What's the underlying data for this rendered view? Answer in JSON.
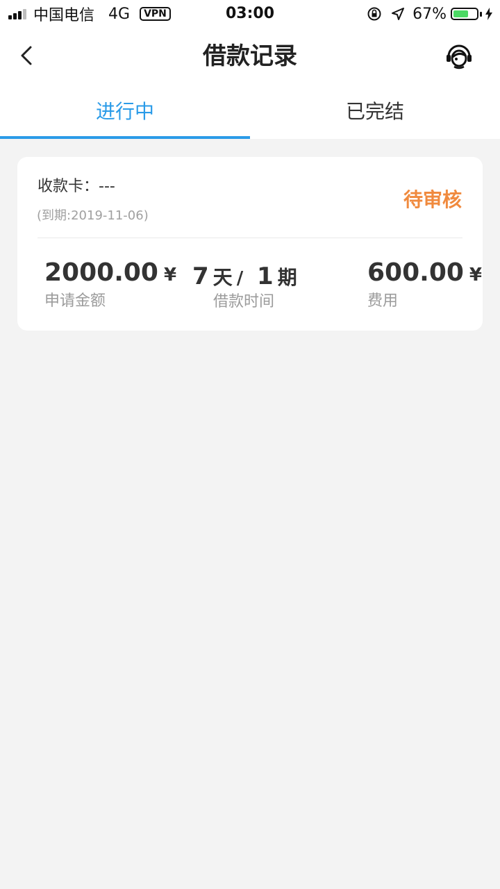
{
  "status_bar": {
    "carrier": "中国电信",
    "network": "4G",
    "vpn": "VPN",
    "time": "03:00",
    "battery_percent": "67%",
    "battery_level": 0.67
  },
  "nav": {
    "title": "借款记录"
  },
  "tabs": [
    {
      "label": "进行中",
      "active": true
    },
    {
      "label": "已完结",
      "active": false
    }
  ],
  "loan": {
    "card_label": "收款卡：---",
    "due": "(到期:2019-11-06)",
    "status": "待审核",
    "amount": "2000.00",
    "amount_unit": "¥",
    "amount_label": "申请金额",
    "term_days": "7",
    "term_days_unit": "天",
    "term_sep": "/",
    "term_periods": "1",
    "term_periods_unit": "期",
    "term_label": "借款时间",
    "fee": "600.00",
    "fee_unit": "¥",
    "fee_label": "费用"
  },
  "colors": {
    "accent": "#2a9be8",
    "status": "#f08a3e",
    "battery": "#4cd964",
    "background": "#f3f3f3"
  }
}
